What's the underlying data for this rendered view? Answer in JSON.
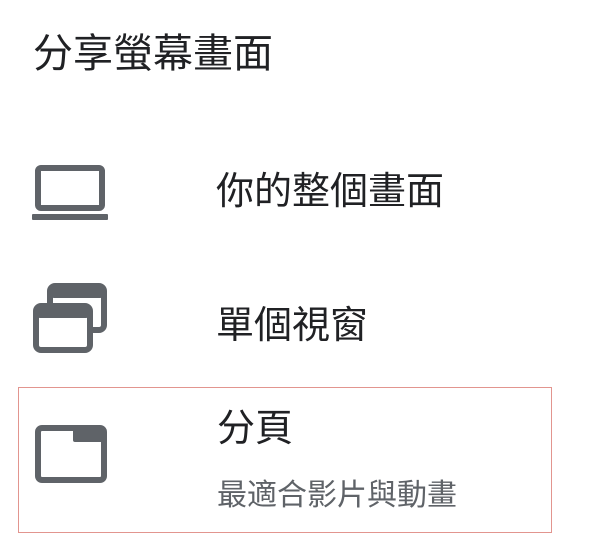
{
  "dialog": {
    "title": "分享螢幕畫面"
  },
  "options": [
    {
      "id": "entire-screen",
      "label": "你的整個畫面",
      "icon": "laptop-icon"
    },
    {
      "id": "window",
      "label": "單個視窗",
      "icon": "windows-icon"
    },
    {
      "id": "tab",
      "label": "分頁",
      "sublabel": "最適合影片與動畫",
      "icon": "tab-icon",
      "selected": true
    }
  ],
  "colors": {
    "text": "#202124",
    "secondary_text": "#5f6368",
    "icon": "#5f6368",
    "selected_border": "#e2958f"
  }
}
